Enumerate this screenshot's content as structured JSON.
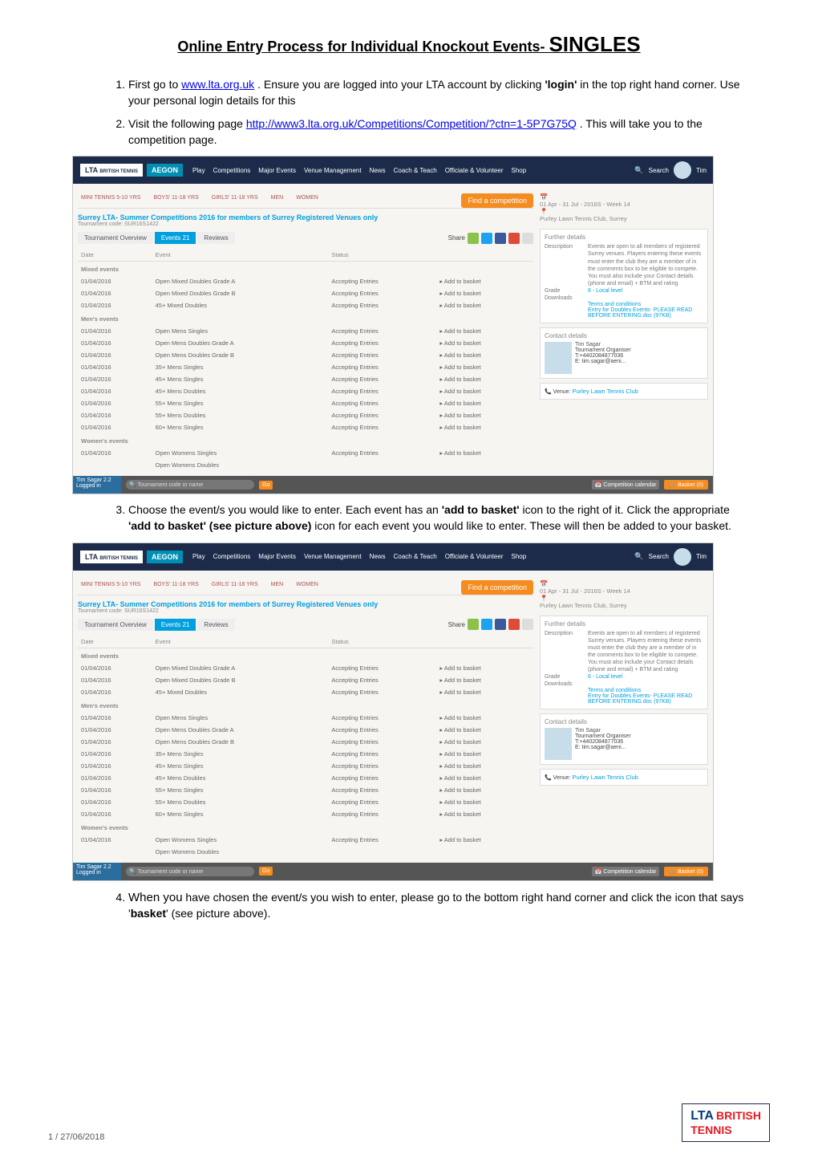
{
  "doc": {
    "title_prefix": "Online Entry Process for Individual Knockout Events- ",
    "title_big": "SINGLES",
    "steps": {
      "s1a": "First go to ",
      "s1_link": "www.lta.org.uk",
      "s1b": " . Ensure you are logged into your LTA account by clicking ",
      "s1_bold": "'login'",
      "s1c": " in the top right hand corner. Use your personal login details for this",
      "s2a": "Visit the following page ",
      "s2_link": "http://www3.lta.org.uk/Competitions/Competition/?ctn=1-5P7G75Q",
      "s2b": " . This will take you to the competition page.",
      "s3a": "Choose the event/s you would like to enter. Each event has an ",
      "s3_bold1": "'add to basket'",
      "s3b": " icon to the right of it. Click the appropriate ",
      "s3_bold2": "'add to basket' (see picture above)",
      "s3c": " icon for each event you would like to enter. These will then be added to your basket.",
      "s4a": "When you",
      "s4b": " have chosen the event/s you wish to enter, please go to the bottom right hand corner and click the icon that says '",
      "s4_bold": "basket",
      "s4c": "' (see picture above)."
    },
    "page_meta": "1 / 27/06/2018"
  },
  "shot": {
    "brand": {
      "lta": "LTA",
      "tennis": "BRITISH TENNIS",
      "aegon": "AEGON"
    },
    "topnav": [
      "Play",
      "Competitions",
      "Major Events",
      "Venue Management",
      "News",
      "Coach & Teach",
      "Officiate & Volunteer",
      "Shop"
    ],
    "search_label": "Search",
    "user_name": "Tim",
    "cat_tabs": [
      "MINI TENNIS 5-10 YRS",
      "BOYS' 11-18 YRS",
      "GIRLS' 11-18 YRS",
      "MEN",
      "WOMEN"
    ],
    "find_btn": "Find a competition",
    "comp_title": "Surrey LTA- Summer Competitions 2016 for members of Surrey Registered Venues only",
    "comp_code": "Tournament code: SUR16S1422",
    "date_line1": "01 Apr - 31 Jul - 2016S - Week 14",
    "date_line2": "Purley Lawn Tennis Club, Surrey",
    "tabs": {
      "overview": "Tournament Overview",
      "events": "Events",
      "events_count": "21",
      "reviews": "Reviews"
    },
    "share_label": "Share",
    "table": {
      "headers": {
        "date": "Date",
        "event": "Event",
        "status": "Status"
      },
      "sections": [
        {
          "title": "Mixed events",
          "rows": [
            {
              "date": "01/04/2016",
              "event": "Open Mixed Doubles Grade A",
              "status": "Accepting Entries",
              "add": "▸ Add to basket"
            },
            {
              "date": "01/04/2016",
              "event": "Open Mixed Doubles Grade B",
              "status": "Accepting Entries",
              "add": "▸ Add to basket"
            },
            {
              "date": "01/04/2016",
              "event": "45+ Mixed Doubles",
              "status": "Accepting Entries",
              "add": "▸ Add to basket"
            }
          ]
        },
        {
          "title": "Men's events",
          "rows": [
            {
              "date": "01/04/2016",
              "event": "Open Mens Singles",
              "status": "Accepting Entries",
              "add": "▸ Add to basket"
            },
            {
              "date": "01/04/2016",
              "event": "Open Mens Doubles Grade A",
              "status": "Accepting Entries",
              "add": "▸ Add to basket"
            },
            {
              "date": "01/04/2016",
              "event": "Open Mens Doubles Grade B",
              "status": "Accepting Entries",
              "add": "▸ Add to basket"
            },
            {
              "date": "01/04/2016",
              "event": "35+ Mens Singles",
              "status": "Accepting Entries",
              "add": "▸ Add to basket"
            },
            {
              "date": "01/04/2016",
              "event": "45+ Mens Singles",
              "status": "Accepting Entries",
              "add": "▸ Add to basket"
            },
            {
              "date": "01/04/2016",
              "event": "45+ Mens Doubles",
              "status": "Accepting Entries",
              "add": "▸ Add to basket"
            },
            {
              "date": "01/04/2016",
              "event": "55+ Mens Singles",
              "status": "Accepting Entries",
              "add": "▸ Add to basket"
            },
            {
              "date": "01/04/2016",
              "event": "55+ Mens Doubles",
              "status": "Accepting Entries",
              "add": "▸ Add to basket"
            },
            {
              "date": "01/04/2016",
              "event": "60+ Mens Singles",
              "status": "Accepting Entries",
              "add": "▸ Add to basket"
            }
          ]
        },
        {
          "title": "Women's events",
          "rows": [
            {
              "date": "01/04/2016",
              "event": "Open Womens Singles",
              "status": "Accepting Entries",
              "add": "▸ Add to basket"
            },
            {
              "date": "",
              "event": "Open Womens Doubles",
              "status": "",
              "add": ""
            }
          ]
        }
      ]
    },
    "side": {
      "further_title": "Further details",
      "desc_label": "Description",
      "desc_text": "Events are open to all members of registered Surrey venues. Players entering these events must enter the club they are a member of in the comments box to be eligible to compete. You must also include your Contact details (phone and email) + BTM and rating",
      "grade_label": "Grade",
      "grade_value": "6 - Local level",
      "downloads_label": "Downloads",
      "download1": "Terms and conditions",
      "download2": "Entry for Doubles Events- PLEASE READ BEFORE ENTERING.doc (97KB)",
      "contact_title": "Contact details",
      "contact_name": "Tim Sagar",
      "contact_role": "Tournament Organiser",
      "contact_tel": "T:+4402084877036",
      "contact_email": "E: tim.sagar@aeni...",
      "venue_label": "Venue:",
      "venue_value": "Purley Lawn Tennis Club"
    },
    "corner": {
      "line1": "Tim Sagar 2.2",
      "line2": "Logged in"
    },
    "bottom": {
      "search_placeholder": "Tournament code or name",
      "go": "Go",
      "cal": "Competition calendar",
      "basket": "Basket (0)"
    }
  },
  "footer_logo": {
    "l1": "LTA",
    "l2": "BRITISH",
    "l3": "TENNIS"
  }
}
